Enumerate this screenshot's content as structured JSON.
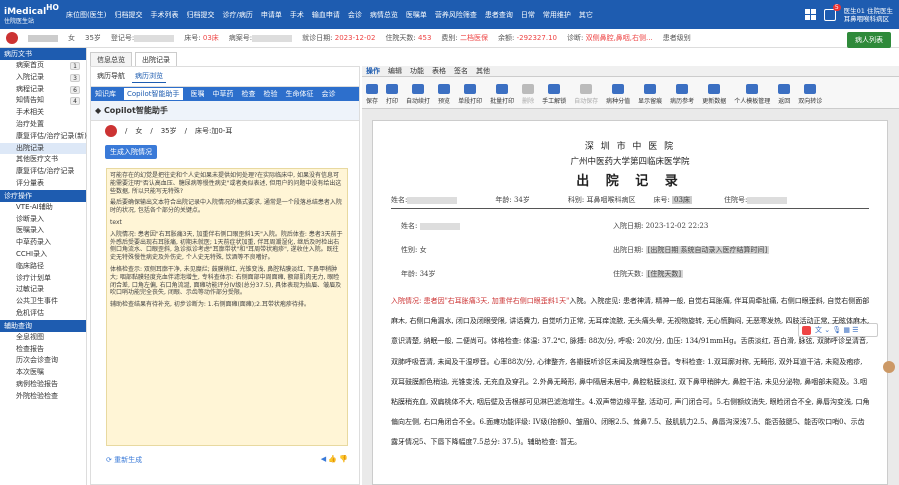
{
  "app": {
    "logo": "iMedical",
    "logo_sub": "住院医生站",
    "logo_ho": "HO"
  },
  "topmenu": [
    "床位图(医生)",
    "归档提交",
    "手术列表",
    "归档提交",
    "诊疗/病历",
    "申请单",
    "手术",
    "输血申请",
    "会诊",
    "病情总览",
    "医嘱单",
    "营养风险筛查",
    "患者查询",
    "日常",
    "常用维护",
    "其它"
  ],
  "user": {
    "name": "医生01",
    "dept": "住院医生",
    "ward": "耳鼻咽喉科病区",
    "badge": "5"
  },
  "patient": {
    "sex": "女",
    "age": "35岁",
    "reg_label": "登记号:",
    "bed_label": "床号:",
    "bed": "03床",
    "case_label": "病案号:",
    "admit_label": "就诊日期:",
    "admit_date": "2023-12-02",
    "days_label": "住院天数:",
    "days": "453",
    "fee_label": "费别:",
    "fee": "二档医保",
    "bal_label": "余额:",
    "balance": "-292327.10",
    "diag_label": "诊断:",
    "diag": "双侧鼻腔,鼻咽,右侧...",
    "extra": "患者级别",
    "btn": "病人列表"
  },
  "sidebar": {
    "head": "病历文书",
    "items": [
      {
        "label": "病案首页",
        "count": "1"
      },
      {
        "label": "入院记录",
        "count": "3"
      },
      {
        "label": "病程记录",
        "count": "6"
      },
      {
        "label": "知情告知",
        "count": "4"
      },
      {
        "label": "手术相关"
      },
      {
        "label": "治疗处置"
      },
      {
        "label": "康复评估/治疗记录(新)"
      },
      {
        "label": "出院记录"
      },
      {
        "label": "其他医疗文书"
      },
      {
        "label": "康复评估/治疗记录"
      },
      {
        "label": "评分量表"
      }
    ],
    "head2": "诊疗操作",
    "items2": [
      "VTE-AI辅助",
      "诊断录入",
      "医嘱录入",
      "中草药录入",
      "CCHI录入",
      "临床路径",
      "诊疗计划单",
      "过敏记录",
      "公共卫生事件",
      "危机评估"
    ],
    "head3": "辅助查询",
    "items3": [
      "全息视图",
      "检查报告",
      "历次会诊查询",
      "本次医嘱",
      "病例检验报告",
      "外院检验检查"
    ]
  },
  "tabs1": [
    "信息总览",
    "出院记录"
  ],
  "tabs2": [
    "病历导航",
    "病历浏览"
  ],
  "bluebar": [
    "知识库",
    "Copilot智能助手",
    "医嘱",
    "中草药",
    "检查",
    "检验",
    "生命体征",
    "会诊"
  ],
  "copilot": {
    "title": "Copilot智能助手",
    "sex": "女",
    "age": "35岁",
    "bed": "床号:加0-耳",
    "gen_btn": "生成入院情况",
    "p1": "可能存在的幻觉是把往史和个人史如果未提供如何处理?在实际临床中, 如果没有信息可能需要注明\"否认高血压、糖尿病等慢性病史\"或者类似表述, 但用户的问题中没有给出这些数据, 所以只能写无特殊?",
    "p2": "最后要确保输出文本符合出院记录中入院情况的格式要求, 通常是一个段落总结患者入院时的状况, 包括各个部分的关键点。",
    "p3": "text",
    "p4": "入院情况: 患者因\"右耳胀痛3天, 加重伴右侧口眼歪斜1天\"入院。院后体查: 患者3天前于外感后受要出现右耳胀痛, 初期未就医; 1天前症状加重, 伴耳周潮湿化, 继后及时检出右侧口角流水、口眼歪斜, 急诊拟诊考虑\"耳廓带状\"和\"耳周带状疱疹\", 遂收住入院。既往史无特殊慢性病史及外伤史, 个人史无特殊, 饮酒等不良嗜好。",
    "p5": "体格检查示: 双侧耳廓干净, 未见糜烂; 鼓膜稍红, 光锥变浅, 鼻腔粘膜淡红, 下鼻甲稍肿大; 咽部黏膜轻度充血伴滤泡增生, 专科查体示: 右侧面部中周面瘫, 额部肌肉无力, 眼睑闭合差, 口角左偏, 右口角流涎, 面瘫功能评分IV级(总分37.5), 具体表现为抬眉、皱眉及吹口哨功能完全丧失, 闭眼、示齿等动作部分受限。",
    "p6": "辅助检查结果有待补充, 初步诊断为: 1.右侧面瘫(面瘫);2.耳带状疱疹待排。",
    "regen": "重新生成"
  },
  "rtabs": [
    "操作",
    "编辑",
    "功能",
    "表格",
    "签名",
    "其他"
  ],
  "toolbar": [
    {
      "l": "保存"
    },
    {
      "l": "打印"
    },
    {
      "l": "自动续打"
    },
    {
      "l": "预览"
    },
    {
      "l": "单段打印"
    },
    {
      "l": "批量打印"
    },
    {
      "l": "删除",
      "d": true
    },
    {
      "l": "手工解锁"
    },
    {
      "l": "自动保存",
      "d": true
    },
    {
      "l": "病种分值"
    },
    {
      "l": "显示留痕"
    },
    {
      "l": "病历参考"
    },
    {
      "l": "更新数据"
    },
    {
      "l": "个人模板管理"
    },
    {
      "l": "返回"
    },
    {
      "l": "双向转诊"
    }
  ],
  "doc": {
    "city": "深 圳 市 中 医 院",
    "hosp": "广州中医药大学第四临床医学院",
    "title": "出 院 记 录",
    "name_label": "姓名:",
    "age_label": "年龄: 34岁",
    "dept_label": "科别: 耳鼻咽喉科病区",
    "bed_label": "床号:",
    "bed": "03床",
    "reg_label": "住院号:",
    "f_name": "姓名:",
    "f_admit": "入院日期: 2023-12-02  22:23",
    "f_sex": "性别: 女",
    "f_dis": "出院日期:",
    "f_dis_val": "[出院日期 系统自动录入医疗结算时间]",
    "f_age": "年龄: 34岁",
    "f_days": "住院天数:",
    "f_days_val": "[住院天数]",
    "body_red": "入院情况: 患者因\"右耳胀痛3天, 加重伴右侧口眼歪斜1天\"",
    "body": "入院。入院症见: 患者神清, 精神一般, 自觉右耳胀痛, 伴耳周牵扯痛, 右侧口眼歪斜, 自觉右侧面部麻木, 右侧口角漏水, 闭口及闭眼受限, 讲话費力, 自觉听力正常, 无耳痒流脓, 无头痛头晕, 无视物旋转, 无心慌胸闷, 无恶寒发热, 四肢活动正常, 无眩体麻木, 意识清楚, 纳眠一般, 二便尚可。体格检查: 体温: 37.2℃, 脉搏: 88次/分, 呼吸: 20次/分, 血压: 134/91mmHg。舌质淡红, 苔白滑, 脉弦, 双肺呼诊呈清音, 双肺呼吸音清, 未闻及干湿啰音。心率88次/分, 心律整齐, 各瓣膜听诊区未闻及病理性杂音。专科检查: 1.双耳廓对称, 无畸形, 双外耳道干洁, 未窥及疱疹, 双耳鼓膜颜色稍油, 光锥变浅, 无充血及穿孔。2.外鼻无畸形, 鼻中隔居未居中, 鼻腔粘膜淡红, 双下鼻甲稍肿大, 鼻腔干洁, 未见分泌物, 鼻咽部未窥及。3.咽粘膜稍充血, 双扁桃体不大, 咽后壁及舌根部可见淋巴滤泡增生。4.双声带边缘平整, 活动可, 声门闭合可。5.右侧额纹消失, 眼睑闭合不全, 鼻唇沟变浅, 口角偏向左侧, 右口角闭合不全。6.面瘫功能评级: IV级(抬额0、皱眉0、闭眼2.5、耸鼻7.5、鼓肌肌力2.5、鼻唇沟深浅7.5、能否鼓腮5、能否吹口哨0、示齿露牙情况5、下唇下降幅度7.5总分: 37.5)。辅助检查: 暂无。"
  }
}
